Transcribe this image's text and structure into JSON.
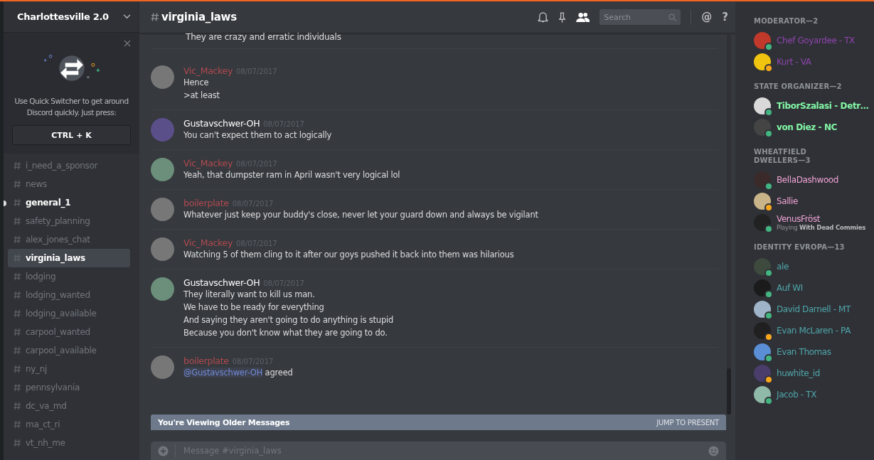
{
  "server": {
    "name": "Charlottesville 2.0"
  },
  "quick_switcher": {
    "text": "Use Quick Switcher to get around Discord quickly. Just press:",
    "shortcut": "CTRL + K"
  },
  "channels": [
    {
      "name": "i_need_a_sponsor",
      "selected": false,
      "unread": false
    },
    {
      "name": "news",
      "selected": false,
      "unread": false
    },
    {
      "name": "general_1",
      "selected": false,
      "unread": true
    },
    {
      "name": "safety_planning",
      "selected": false,
      "unread": false
    },
    {
      "name": "alex_jones_chat",
      "selected": false,
      "unread": false
    },
    {
      "name": "virginia_laws",
      "selected": true,
      "unread": false
    },
    {
      "name": "lodging",
      "selected": false,
      "unread": false
    },
    {
      "name": "lodging_wanted",
      "selected": false,
      "unread": false
    },
    {
      "name": "lodging_available",
      "selected": false,
      "unread": false
    },
    {
      "name": "carpool_wanted",
      "selected": false,
      "unread": false
    },
    {
      "name": "carpool_available",
      "selected": false,
      "unread": false
    },
    {
      "name": "ny_nj",
      "selected": false,
      "unread": false
    },
    {
      "name": "pennsylvania",
      "selected": false,
      "unread": false
    },
    {
      "name": "dc_va_md",
      "selected": false,
      "unread": false
    },
    {
      "name": "ma_ct_ri",
      "selected": false,
      "unread": false
    },
    {
      "name": "vt_nh_me",
      "selected": false,
      "unread": false
    }
  ],
  "header": {
    "channel": "virginia_laws",
    "search_placeholder": "Search",
    "mentions_glyph": "@",
    "help_glyph": "?"
  },
  "partial_message": "They are crazy and erratic individuals",
  "messages": [
    {
      "author": "Vic_Mackey",
      "color": "#b04a4f",
      "time": "08/07/2017",
      "lines": [
        "Hence",
        ">at least"
      ]
    },
    {
      "author": "Gustavschwer-OH",
      "color": "#ffffff",
      "time": "08/07/2017",
      "lines": [
        "You can't expect them to act logically"
      ]
    },
    {
      "author": "Vic_Mackey",
      "color": "#b04a4f",
      "time": "08/07/2017",
      "lines": [
        "Yeah, that dumpster ram in April wasn't very logical lol"
      ]
    },
    {
      "author": "boilerplate",
      "color": "#b04a4f",
      "time": "08/07/2017",
      "lines": [
        "Whatever just keep your buddy's close,  never let your guard down and always be vigilant"
      ]
    },
    {
      "author": "Vic_Mackey",
      "color": "#b04a4f",
      "time": "08/07/2017",
      "lines": [
        "Watching 5 of them cling to it after our goys pushed it back into them was hilarious"
      ]
    },
    {
      "author": "Gustavschwer-OH",
      "color": "#ffffff",
      "time": "08/07/2017",
      "lines": [
        "They literally want to kill us man.",
        "We have to be ready for everything",
        "And saying they aren't going to do anything is stupid",
        "Because you don't know what they are going to do."
      ]
    },
    {
      "author": "boilerplate",
      "color": "#b04a4f",
      "time": "08/07/2017",
      "lines": [
        {
          "mention": "@Gustavschwer-OH",
          "text": "agreed"
        }
      ]
    }
  ],
  "older_bar": {
    "text": "You're Viewing Older Messages",
    "action": "JUMP TO PRESENT"
  },
  "composer": {
    "placeholder": "Message #virginia_laws"
  },
  "member_groups": [
    {
      "title": "MODERATOR—2",
      "color": "#8e44ad",
      "members": [
        {
          "name": "Chef Goyardee - TX",
          "idle": false
        },
        {
          "name": "Kurt - VA",
          "idle": true
        }
      ]
    },
    {
      "title": "STATE ORGANIZER—2",
      "color": "#82f7a6",
      "members": [
        {
          "name": "TiborSzalasi - Detr…",
          "idle": false
        },
        {
          "name": "von Diez - NC",
          "idle": false
        }
      ]
    },
    {
      "title": "WHEATFIELD DWELLERS—3",
      "color": "#f0a3d5",
      "members": [
        {
          "name": "BellaDashwood",
          "idle": false
        },
        {
          "name": "Sallie",
          "idle": true
        },
        {
          "name": "VenusFröst",
          "idle": false,
          "activity": "Playing **With Dead Commies**"
        }
      ]
    },
    {
      "title": "IDENTITY EVROPA—13",
      "color": "#4fa6aa",
      "members": [
        {
          "name": "ale",
          "idle": false
        },
        {
          "name": "Auf WI",
          "idle": false
        },
        {
          "name": "David Darnell - MT",
          "idle": false
        },
        {
          "name": "Evan McLaren - PA",
          "idle": true
        },
        {
          "name": "Evan Thomas",
          "idle": false
        },
        {
          "name": "huwhite_id",
          "idle": true
        },
        {
          "name": "Jacob - TX",
          "idle": false
        }
      ]
    }
  ]
}
